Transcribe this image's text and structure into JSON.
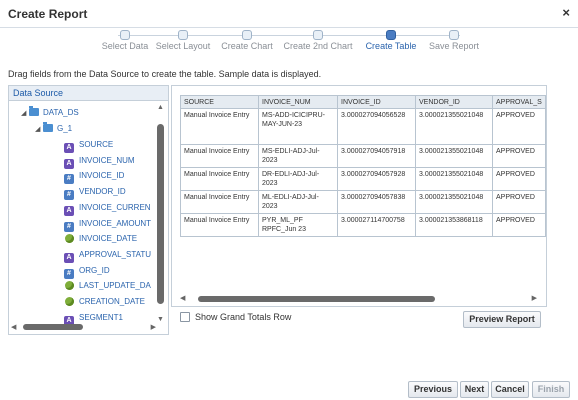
{
  "dialog": {
    "title": "Create Report",
    "close": "×"
  },
  "train": {
    "steps": [
      {
        "label": "Select Data"
      },
      {
        "label": "Select Layout"
      },
      {
        "label": "Create Chart"
      },
      {
        "label": "Create 2nd Chart"
      },
      {
        "label": "Create Table",
        "active": true
      },
      {
        "label": "Save Report"
      }
    ]
  },
  "instruction": "Drag fields from the Data Source to create the table. Sample data is displayed.",
  "data_source": {
    "header": "Data Source",
    "root": "DATA_DS",
    "group": "G_1",
    "fields": [
      {
        "label": "SOURCE",
        "icon": "text-field-icon"
      },
      {
        "label": "INVOICE_NUM",
        "icon": "text-field-icon"
      },
      {
        "label": "INVOICE_ID",
        "icon": "number-field-icon"
      },
      {
        "label": "VENDOR_ID",
        "icon": "number-field-icon"
      },
      {
        "label": "INVOICE_CURREN",
        "icon": "text-field-icon"
      },
      {
        "label": "INVOICE_AMOUNT",
        "icon": "number-field-icon"
      },
      {
        "label": "INVOICE_DATE",
        "icon": "date-field-icon"
      },
      {
        "label": "APPROVAL_STATU",
        "icon": "text-field-icon"
      },
      {
        "label": "ORG_ID",
        "icon": "number-field-icon"
      },
      {
        "label": "LAST_UPDATE_DA",
        "icon": "date-field-icon"
      },
      {
        "label": "CREATION_DATE",
        "icon": "date-field-icon"
      },
      {
        "label": "SEGMENT1",
        "icon": "text-field-icon"
      }
    ]
  },
  "table": {
    "columns": [
      "SOURCE",
      "INVOICE_NUM",
      "INVOICE_ID",
      "VENDOR_ID",
      "APPROVAL_S"
    ],
    "rows": [
      [
        "Manual Invoice Entry",
        "MS-ADD-ICICIPRU-MAY-JUN-23",
        "3.000027094056528",
        "3.000021355021048",
        "APPROVED"
      ],
      [
        "Manual Invoice Entry",
        "MS-EDLI-ADJ-Jul-2023",
        "3.000027094057918",
        "3.000021355021048",
        "APPROVED"
      ],
      [
        "Manual Invoice Entry",
        "DR-EDLI-ADJ-Jul-2023",
        "3.000027094057928",
        "3.000021355021048",
        "APPROVED"
      ],
      [
        "Manual Invoice Entry",
        "ML-EDLI-ADJ-Jul-2023",
        "3.000027094057838",
        "3.000021355021048",
        "APPROVED"
      ],
      [
        "Manual Invoice Entry",
        "PYR_ML_PF RPFC_Jun 23",
        "3.000027114700758",
        "3.000021353868118",
        "APPROVED"
      ]
    ]
  },
  "grand_totals": {
    "label": "Show Grand Totals Row",
    "checked": false
  },
  "buttons": {
    "preview": "Preview Report",
    "previous": "Previous",
    "next": "Next",
    "cancel": "Cancel",
    "finish": "Finish"
  },
  "colors": {
    "accent": "#2b64ad",
    "panel_header": "#e8eef5",
    "text_field": "#6b4fb5",
    "number_field": "#4a7cc2",
    "date_field": "#7fae3a"
  }
}
